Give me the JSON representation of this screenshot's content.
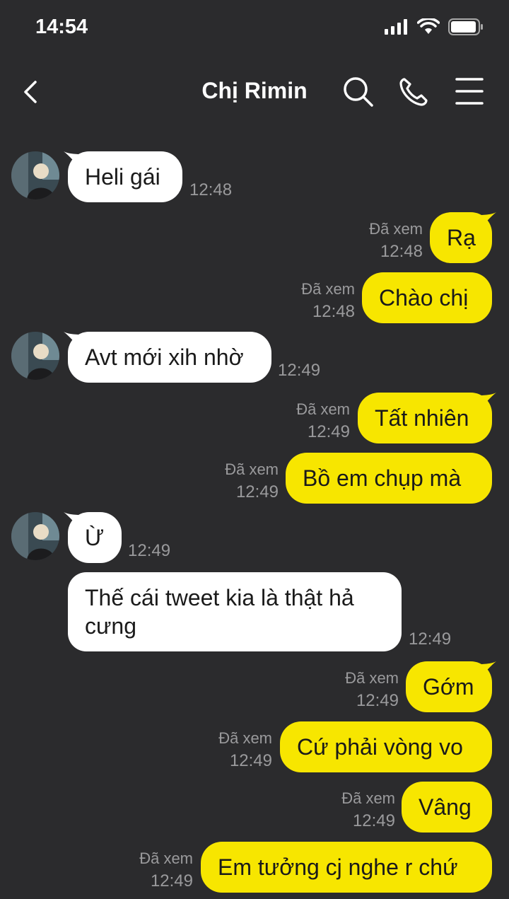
{
  "status": {
    "time": "14:54"
  },
  "header": {
    "title": "Chị Rimin"
  },
  "messages": [
    {
      "text": "Heli gái",
      "time": "12:48"
    },
    {
      "text": "Rạ",
      "seen": "Đã xem",
      "time": "12:48"
    },
    {
      "text": "Chào chị",
      "seen": "Đã xem",
      "time": "12:48"
    },
    {
      "text": "Avt mới xih nhờ",
      "time": "12:49"
    },
    {
      "text": "Tất nhiên",
      "seen": "Đã xem",
      "time": "12:49"
    },
    {
      "text": "Bồ em chụp mà",
      "seen": "Đã xem",
      "time": "12:49"
    },
    {
      "text": "Ừ",
      "time": "12:49"
    },
    {
      "text_line1": "Thế cái tweet kia là thật hả",
      "text_line2": "cưng",
      "time": "12:49"
    },
    {
      "text": "Gớm",
      "seen": "Đã xem",
      "time": "12:49"
    },
    {
      "text": "Cứ phải vòng vo",
      "seen": "Đã xem",
      "time": "12:49"
    },
    {
      "text": "Vâng",
      "seen": "Đã xem",
      "time": "12:49"
    },
    {
      "text": "Em tưởng cj nghe r chứ",
      "seen": "Đã xem",
      "time": "12:49"
    }
  ],
  "colors": {
    "background": "#2b2b2d",
    "outgoing_bubble": "#f7e600",
    "incoming_bubble": "#ffffff",
    "meta_text": "#9a9a9c"
  }
}
